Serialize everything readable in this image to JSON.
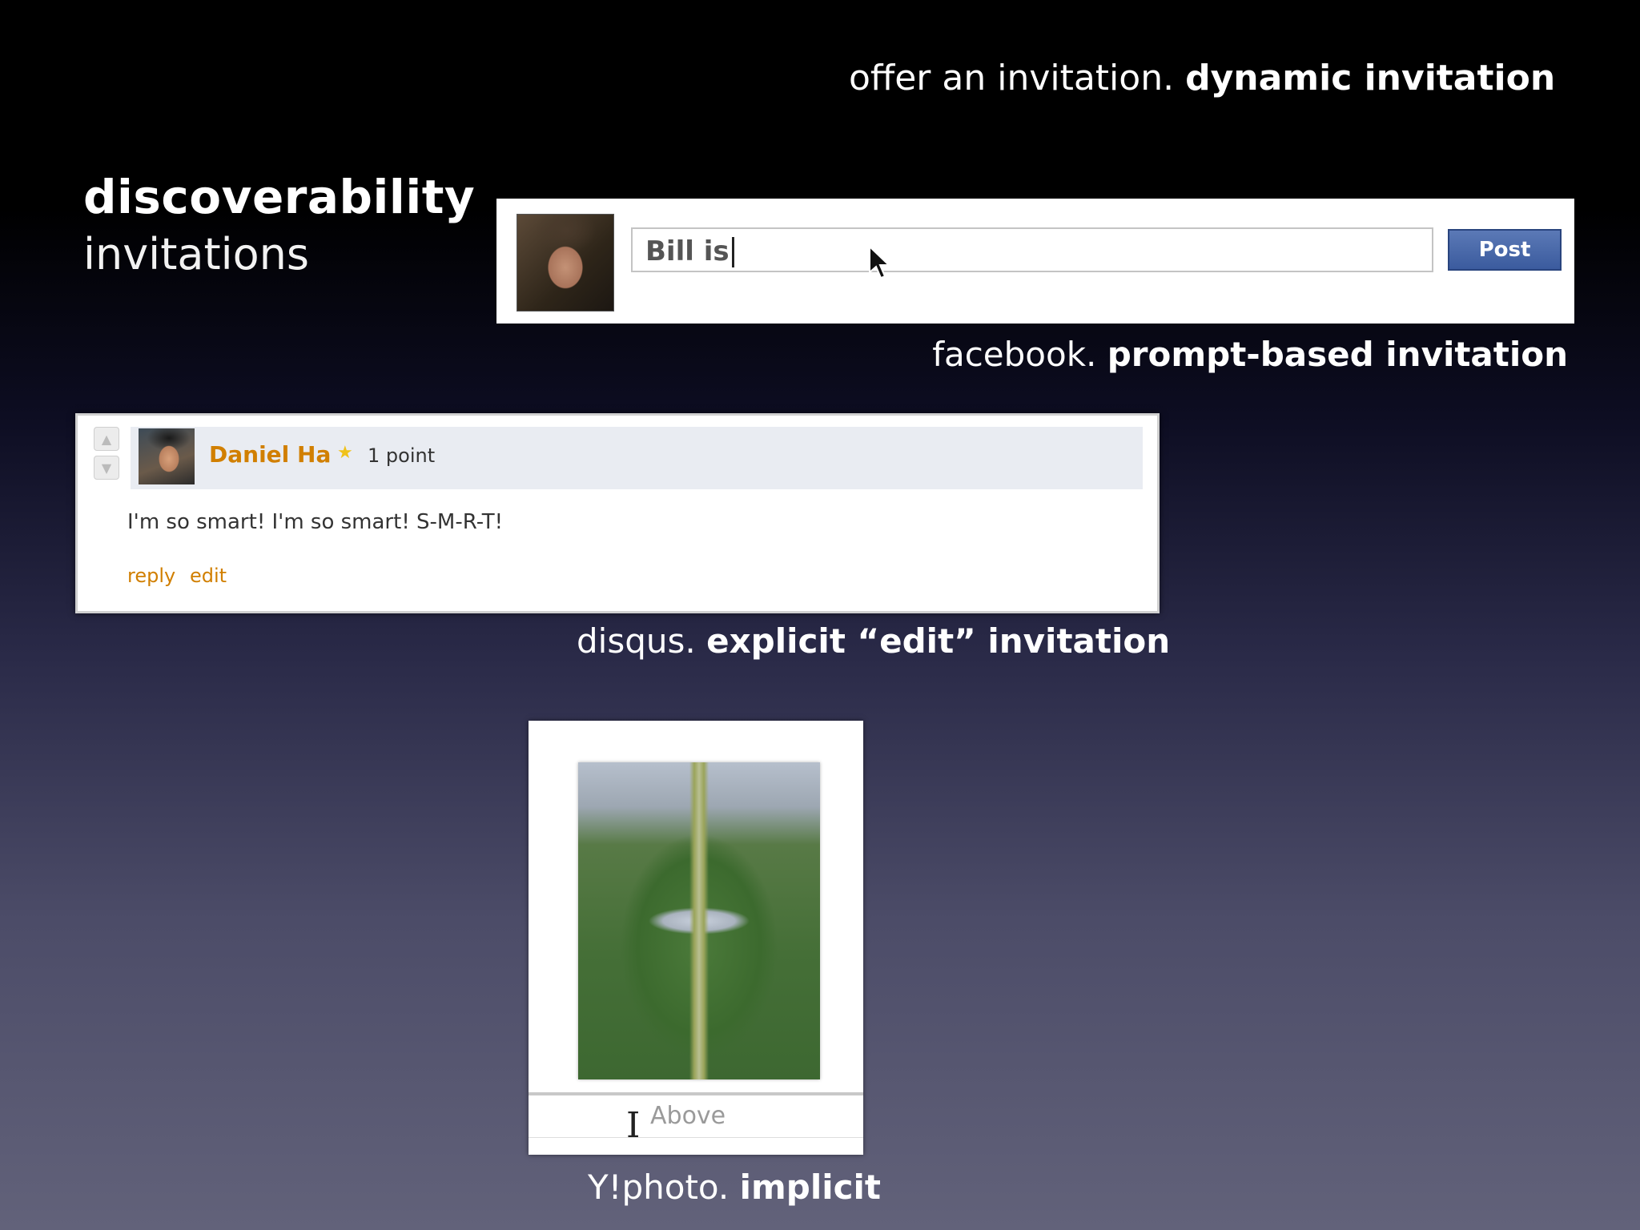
{
  "slide": {
    "top_caption": {
      "light": "offer an invitation.",
      "bold": "dynamic invitation"
    },
    "title": "discoverability",
    "subtitle": "invitations"
  },
  "facebook": {
    "input_value": "Bill is",
    "post_label": "Post",
    "caption": {
      "light": "facebook.",
      "bold": "prompt-based invitation"
    }
  },
  "disqus": {
    "author": "Daniel Ha",
    "points": "1 point",
    "comment": "I'm so smart! I'm so smart! S-M-R-T!",
    "reply_label": "reply",
    "edit_label": "edit",
    "caption": {
      "light": "disqus.",
      "bold": "explicit “edit” invitation"
    }
  },
  "yphoto": {
    "caption_field_text": "Above",
    "caption": {
      "light": "Y!photo.",
      "bold": "implicit"
    }
  },
  "icons": {
    "cursor": "arrow-cursor-icon",
    "ibeam": "text-cursor-icon",
    "star": "star-icon",
    "vote_up": "vote-up-icon",
    "vote_down": "vote-down-icon"
  },
  "colors": {
    "facebook_button": "#3b5b9e",
    "disqus_accent": "#d17f00"
  }
}
